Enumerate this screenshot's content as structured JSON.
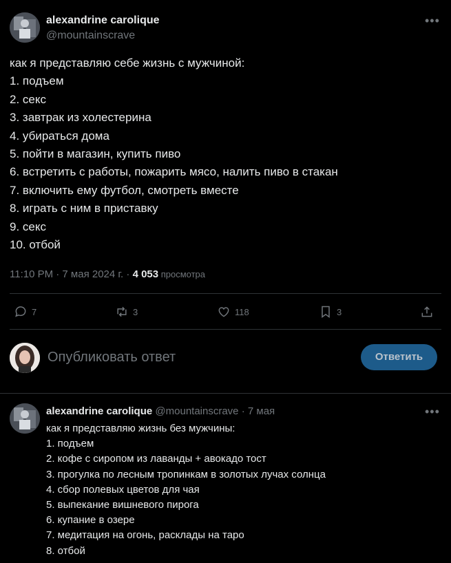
{
  "main_tweet": {
    "author_name": "alexandrine carolique",
    "author_handle": "@mountainscrave",
    "more_icon": "more-horizontal-icon",
    "lines": [
      "как я представляю себе жизнь с мужчиной:",
      "1. подъем",
      "2. секс",
      "3. завтрак из холестерина",
      "4. убираться дома",
      "5. пойти в магазин, купить пиво",
      "6. встретить с работы, пожарить мясо, налить пиво в стакан",
      "7. включить ему футбол, смотреть вместе",
      "8. играть с ним в приставку",
      "9. секс",
      "10. отбой"
    ],
    "timestamp": "11:10 PM · 7 мая 2024 г. · ",
    "views_count": "4 053",
    "views_label": " просмотра"
  },
  "actions": {
    "replies": "7",
    "reposts": "3",
    "likes": "118",
    "bookmarks": "3"
  },
  "composer": {
    "placeholder": "Опубликовать ответ",
    "button_label": "Ответить"
  },
  "reply_tweet": {
    "author_name": "alexandrine carolique",
    "author_handle": "@mountainscrave",
    "separator": " · ",
    "date": "7 мая",
    "lines": [
      "как я представляю жизнь без мужчины:",
      "1. подъем",
      "2. кофе с сиропом из лаванды + авокадо тост",
      "3. прогулка по лесным тропинкам в золотых лучах солнца",
      "4. сбор полевых цветов для чая",
      "5. выпекание вишневого пирога",
      "6. купание в озере",
      "7. медитация на огонь, расклады на таро",
      "8. отбой"
    ]
  },
  "colors": {
    "background": "#000000",
    "text": "#e7e9ea",
    "secondary": "#71767b",
    "divider": "#2f3336",
    "reply_button": "#1d5b8a"
  }
}
